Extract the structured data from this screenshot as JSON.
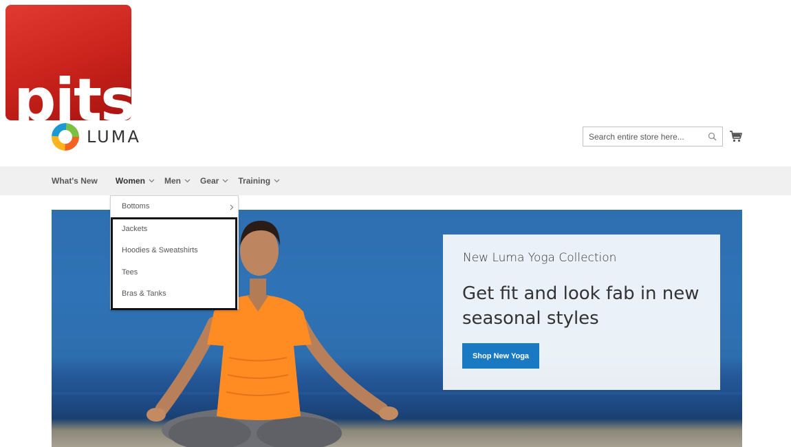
{
  "pits_logo": {
    "text": "pits",
    "color": "#d12a22"
  },
  "store_logo": {
    "text": "LUMA"
  },
  "search": {
    "placeholder": "Search entire store here...",
    "icon": "search-icon"
  },
  "cart": {
    "icon": "cart-icon"
  },
  "nav": {
    "items": [
      {
        "label": "What's New",
        "has_dropdown": false
      },
      {
        "label": "Women",
        "has_dropdown": true
      },
      {
        "label": "Men",
        "has_dropdown": true
      },
      {
        "label": "Gear",
        "has_dropdown": true
      },
      {
        "label": "Training",
        "has_dropdown": true
      }
    ]
  },
  "dropdown": {
    "items": [
      {
        "label": "Bottoms",
        "has_submenu": true
      },
      {
        "label": "Jackets"
      },
      {
        "label": "Hoodies & Sweatshirts"
      },
      {
        "label": "Tees"
      },
      {
        "label": "Bras & Tanks"
      }
    ]
  },
  "hero": {
    "subtitle": "New Luma Yoga Collection",
    "title": "Get fit and look fab in new seasonal styles",
    "button_label": "Shop New Yoga"
  },
  "colors": {
    "accent": "#1979c3",
    "nav_bg": "#f0f0f0",
    "highlight_border": "#111111"
  }
}
